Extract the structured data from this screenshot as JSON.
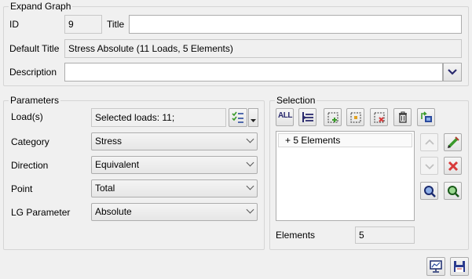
{
  "expand_graph": {
    "title": "Expand Graph",
    "id_label": "ID",
    "id_value": "9",
    "title_label": "Title",
    "title_value": "",
    "default_title_label": "Default Title",
    "default_title_value": "Stress Absolute (11 Loads, 5 Elements)",
    "description_label": "Description",
    "description_value": ""
  },
  "parameters": {
    "title": "Parameters",
    "loads_label": "Load(s)",
    "loads_value": "Selected loads: 11;",
    "category_label": "Category",
    "category_value": "Stress",
    "direction_label": "Direction",
    "direction_value": "Equivalent",
    "point_label": "Point",
    "point_value": "Total",
    "lg_parameter_label": "LG Parameter",
    "lg_parameter_value": "Absolute"
  },
  "selection": {
    "title": "Selection",
    "all_button_label": "ALL",
    "items": [
      "+ 5 Elements"
    ],
    "elements_label": "Elements",
    "elements_value": "5"
  },
  "icons": {
    "all": "all-icon",
    "tree": "tree-select-icon",
    "add_sel": "add-selection-icon",
    "box_sel": "box-selection-icon",
    "remove_sel": "remove-selection-icon",
    "delete": "trash-icon",
    "pick": "pick-icon",
    "up": "arrow-up-icon",
    "down": "arrow-down-icon",
    "edit": "pencil-icon",
    "remove": "red-x-icon",
    "zoom": "zoom-icon",
    "zoom_fit": "zoom-fit-icon",
    "display": "display-icon",
    "save": "save-icon"
  },
  "colors": {
    "accent_blue": "#2a4a9e",
    "edit_green": "#3a9a2a",
    "delete_red": "#d83a3a"
  }
}
